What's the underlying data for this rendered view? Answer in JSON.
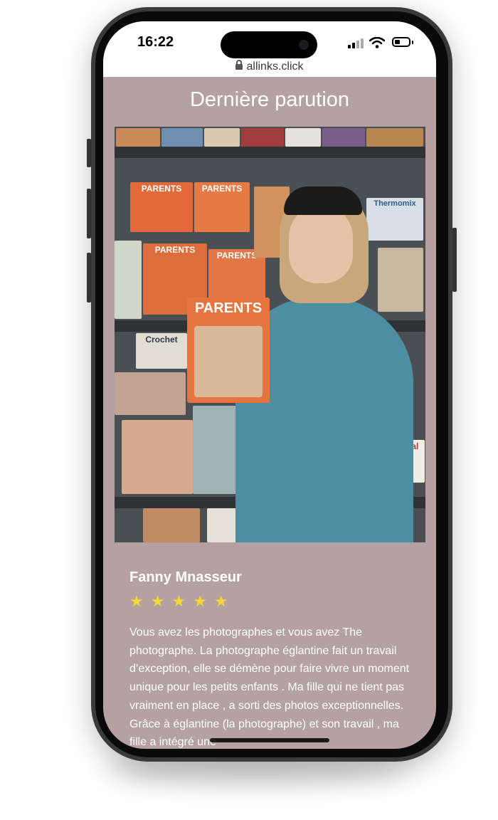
{
  "status_bar": {
    "time": "16:22"
  },
  "browser": {
    "url": "allinks.click"
  },
  "page": {
    "title": "Dernière parution"
  },
  "photo": {
    "held_magazine": "PARENTS",
    "shelf_magazines": [
      "PARENTS",
      "PARENTS",
      "PARENTS",
      "PARENTS",
      "Crochet",
      "Régal",
      "Thermomix"
    ]
  },
  "review": {
    "author": "Fanny Mnasseur",
    "rating": 5,
    "stars": [
      "★",
      "★",
      "★",
      "★",
      "★"
    ],
    "text": "Vous avez les photographes et vous avez The photographe. La photographe églantine fait un travail d’exception, elle se démène pour faire vivre un moment unique pour les petits enfants . Ma fille qui ne tient pas vraiment en place , a sorti des photos exceptionnelles. Grâce à églantine (la photographe) et son travail , ma fille a intégré une"
  },
  "colors": {
    "page_background": "#b5a1a1",
    "star": "#f5d637",
    "coat": "#4e8ea2"
  }
}
